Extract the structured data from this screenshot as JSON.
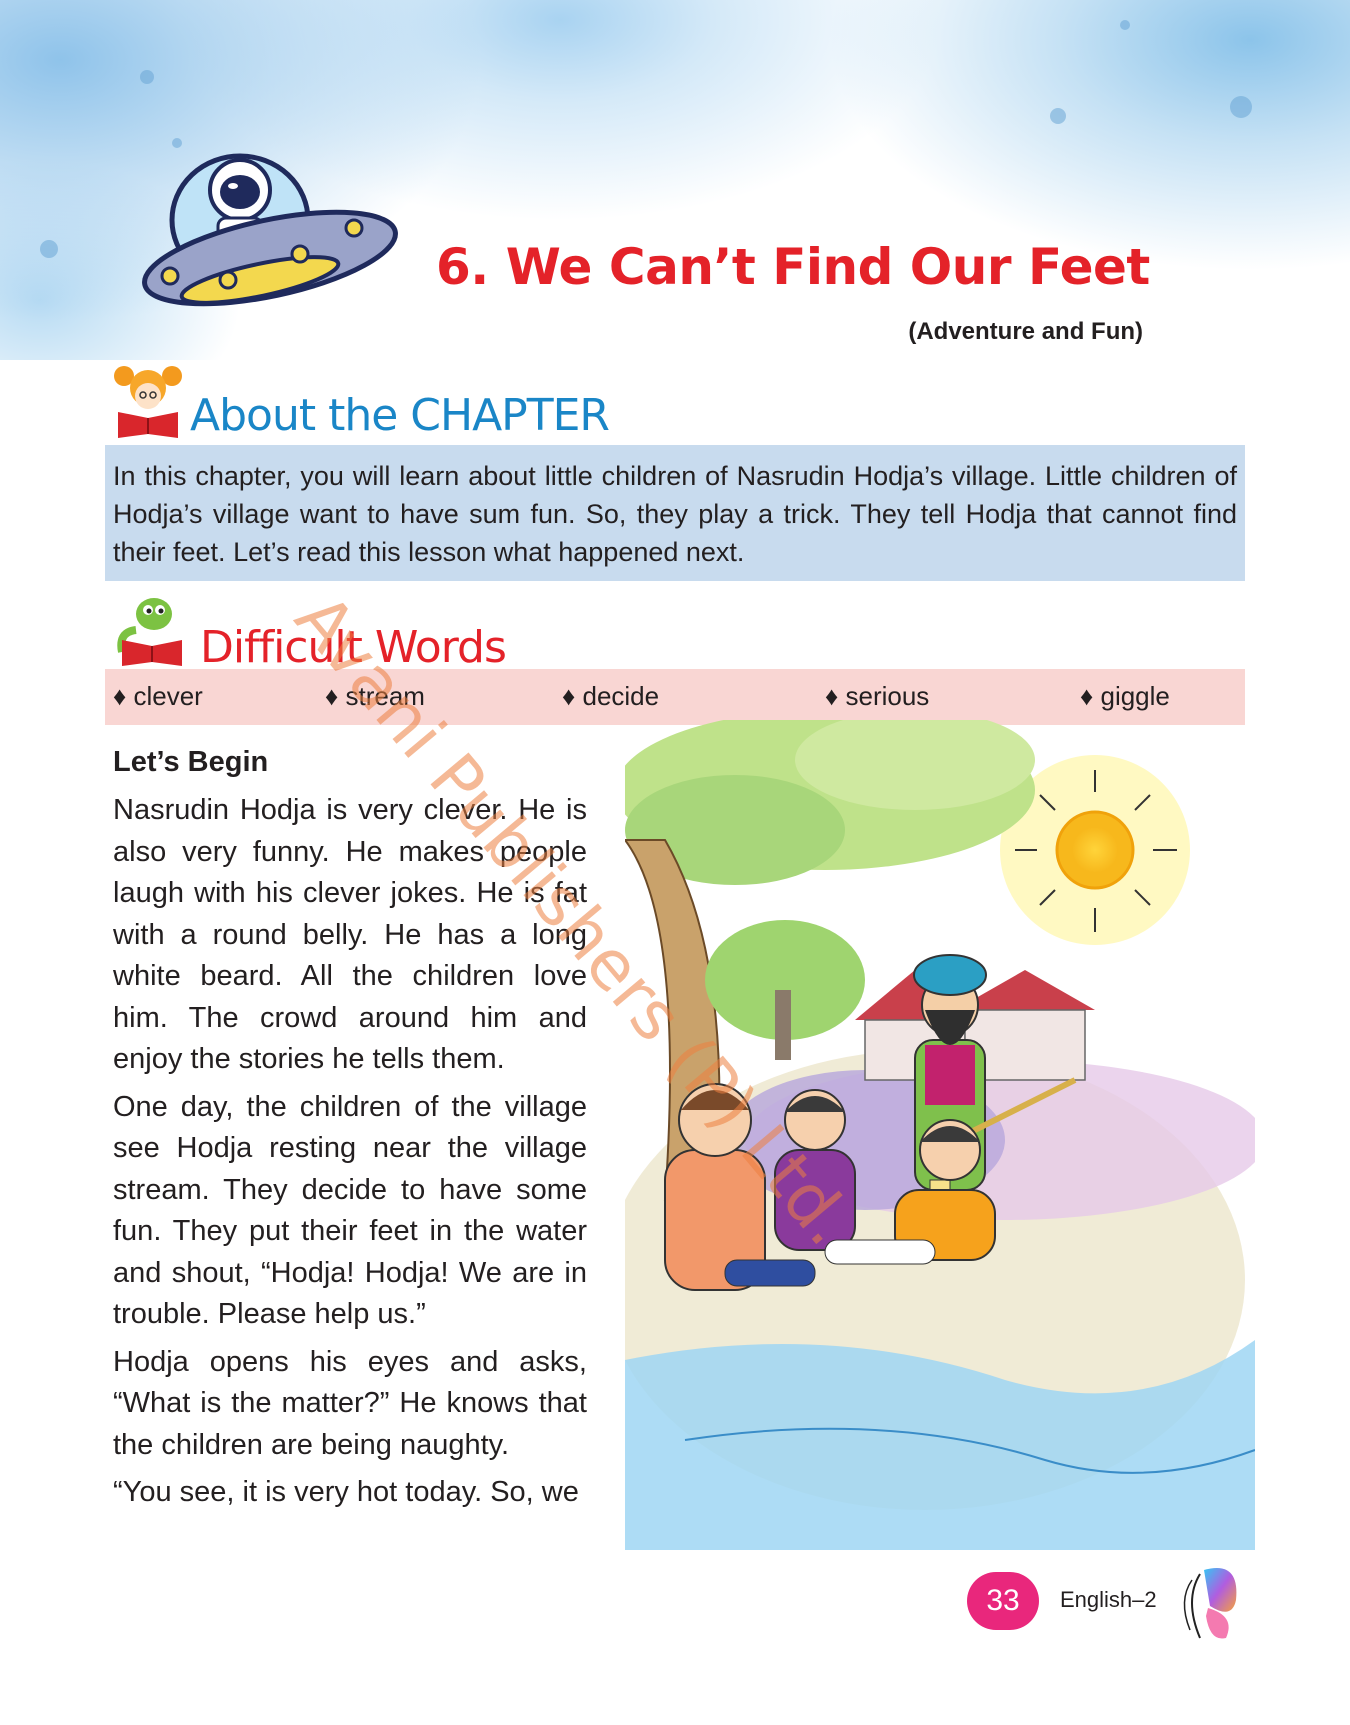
{
  "chapter": {
    "title": "6. We Can’t Find Our Feet",
    "subtitle": "(Adventure and Fun)"
  },
  "about": {
    "heading": "About the CHAPTER",
    "text": "In this chapter, you will learn about little children of Nasrudin Hodja’s village. Little children of Hodja’s village want to have sum fun. So, they play a trick. They tell Hodja that cannot find their feet. Let’s read this lesson what happened next."
  },
  "difficult_words": {
    "heading": "Difficult Words",
    "items": [
      "♦ clever",
      "♦ stream",
      "♦ decide",
      "♦ serious",
      "♦ giggle"
    ]
  },
  "lesson": {
    "heading": "Let’s Begin",
    "paragraphs": [
      "Nasrudin Hodja is very clever. He is also very funny. He makes people laugh with his clever jokes. He is fat with a round belly. He has a long white beard. All the children love him. The crowd around him and enjoy the stories he tells them.",
      "One day, the children of the village see Hodja resting near the village stream. They decide to have some fun. They put their feet in the water and shout, “Hodja! Hodja! We are in trouble. Please help us.”",
      "Hodja opens his eyes and asks, “What is the matter?” He knows that the children are being naughty.",
      "“You see, it is very hot today. So, we"
    ]
  },
  "watermark": "Avani Publishers (P) Ltd.",
  "footer": {
    "page_number": "33",
    "book": "English–2"
  },
  "colors": {
    "title_red": "#e42229",
    "about_blue": "#1a86c7",
    "about_box": "#c8dbee",
    "words_box": "#f9d6d3",
    "page_badge": "#e9277c"
  },
  "icons": [
    "ufo-astronaut-icon",
    "girl-reading-icon",
    "dinosaur-reading-icon",
    "butterfly-icon"
  ]
}
